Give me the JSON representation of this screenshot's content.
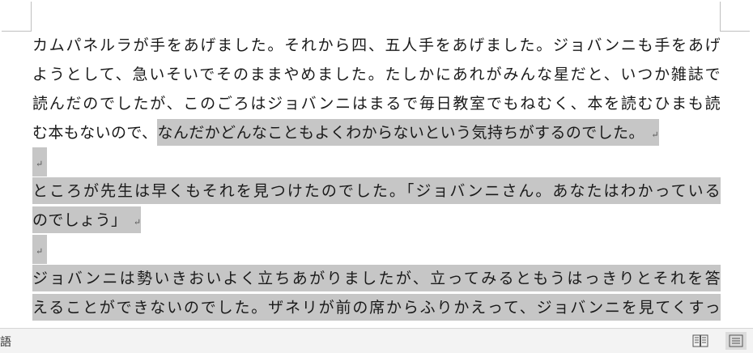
{
  "document": {
    "lines": [
      {
        "text": "カムパネルラが手をあげました。それから四、五人手をあげました。ジョバンニも手をあげ"
      },
      {
        "text": "ようとして、急いそいでそのままやめました。たしかにあれがみんな星だと、いつか雑誌で"
      },
      {
        "text": "読んだのでしたが、このごろはジョバンニはまるで毎日教室でもねむく、本を読むひまも読"
      },
      {
        "plain": "む本もないので、",
        "highlight": "なんだかどんなこともよくわからないという気持ちがするのでした。"
      },
      {
        "highlight": ""
      },
      {
        "highlight": "ところが先生は早くもそれを見つけたのでした。「ジョバンニさん。あなたはわかっている"
      },
      {
        "highlight": "のでしょう」"
      },
      {
        "highlight": ""
      },
      {
        "highlight": "ジョバンニは勢いきおいよく立ちあがりましたが、立ってみるともうはっきりとそれを答"
      },
      {
        "highlight": "えることができないのでした。ザネリが前の席からふりかえって、ジョバンニを見てくすっ"
      }
    ],
    "paragraph_mark": "↵",
    "highlight_color": "#c6c6c6"
  },
  "status_bar": {
    "language": "語",
    "read_mode_icon": "book-icon",
    "print_layout_icon": "page-icon"
  }
}
